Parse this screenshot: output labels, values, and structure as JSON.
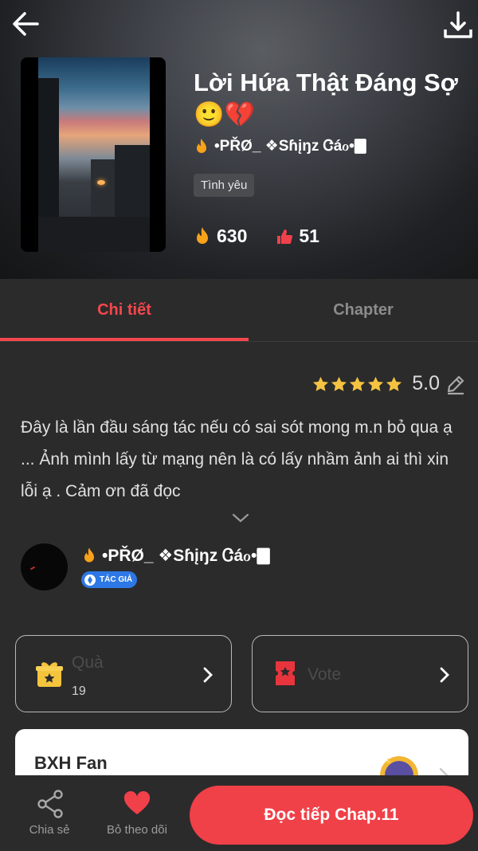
{
  "story": {
    "title": "Lời Hứa Thật Đáng Sợ 🙂💔",
    "author": "•PŘØ_ ❖Sɦįŋz Ꮳáℴ•🀫",
    "genre": "Tình yêu",
    "reads": "630",
    "likes": "51"
  },
  "tabs": [
    {
      "label": "Chi tiết",
      "active": true
    },
    {
      "label": "Chapter",
      "active": false
    }
  ],
  "rating": {
    "value": "5.0",
    "stars": 5
  },
  "description": "Đây là lần đầu sáng tác nếu có sai sót mong m.n bỏ qua ạ ... Ảnh mình lấy từ mạng nên là có lấy nhầm ảnh ai thì xin lỗi ạ . Cảm ơn đã đọc",
  "author_section": {
    "name": "•PŘØ_ ❖Sɦįŋz Ꮳáℴ•🀫",
    "badge": "TÁC GIẢ"
  },
  "gift": {
    "label": "Quà",
    "count": "19"
  },
  "vote": {
    "label": "Vote"
  },
  "fan_ranking": {
    "title": "BXH Fan"
  },
  "bottom": {
    "share_label": "Chia sẻ",
    "follow_label": "Bỏ theo dõi",
    "read_label": "Đọc tiếp Chap.11"
  },
  "colors": {
    "accent": "#f4474d",
    "background": "#2b2b2b",
    "gift_icon": "#f4c43c",
    "vote_icon": "#e8353d",
    "badge": "#2d78e6"
  },
  "icons": {
    "back": "arrow-left-icon",
    "download": "download-icon",
    "reads": "flame-icon",
    "likes": "thumbs-up-icon",
    "edit": "pencil-icon",
    "expand": "chevron-down-icon",
    "gift": "gift-icon",
    "vote": "ticket-icon",
    "share": "share-icon",
    "follow": "heart-icon"
  }
}
